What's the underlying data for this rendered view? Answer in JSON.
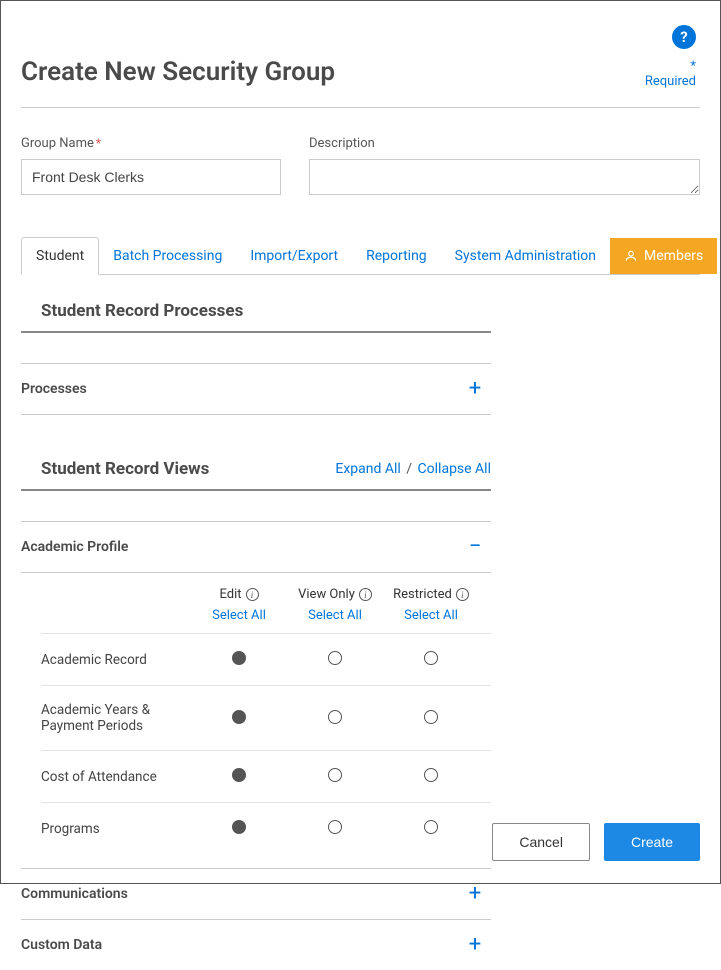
{
  "header": {
    "title": "Create New Security Group",
    "required_label": "Required",
    "help_icon": "?"
  },
  "form": {
    "group_name": {
      "label": "Group Name",
      "value": "Front Desk Clerks",
      "required": true
    },
    "description": {
      "label": "Description",
      "value": ""
    }
  },
  "tabs": [
    {
      "id": "student",
      "label": "Student",
      "active": true
    },
    {
      "id": "batch",
      "label": "Batch Processing"
    },
    {
      "id": "importexport",
      "label": "Import/Export"
    },
    {
      "id": "reporting",
      "label": "Reporting"
    },
    {
      "id": "sysadmin",
      "label": "System Administration"
    },
    {
      "id": "members",
      "label": "Members",
      "highlight": true
    }
  ],
  "sections": {
    "processes_title": "Student Record Processes",
    "processes_row_label": "Processes",
    "views_title": "Student Record Views",
    "expand_all": "Expand All",
    "collapse_all": "Collapse All",
    "separator": "/"
  },
  "permissions": {
    "academic_profile": {
      "label": "Academic Profile",
      "expanded": true,
      "columns": [
        {
          "id": "edit",
          "label": "Edit",
          "select_all": "Select All"
        },
        {
          "id": "view",
          "label": "View Only",
          "select_all": "Select All"
        },
        {
          "id": "restricted",
          "label": "Restricted",
          "select_all": "Select All"
        }
      ],
      "rows": [
        {
          "label": "Academic Record",
          "selected": "edit"
        },
        {
          "label": "Academic Years & Payment Periods",
          "selected": "edit"
        },
        {
          "label": "Cost of Attendance",
          "selected": "edit"
        },
        {
          "label": "Programs",
          "selected": "edit"
        }
      ]
    },
    "communications": {
      "label": "Communications",
      "expanded": false
    },
    "custom_data": {
      "label": "Custom Data",
      "expanded": false
    }
  },
  "footer": {
    "cancel": "Cancel",
    "create": "Create"
  }
}
